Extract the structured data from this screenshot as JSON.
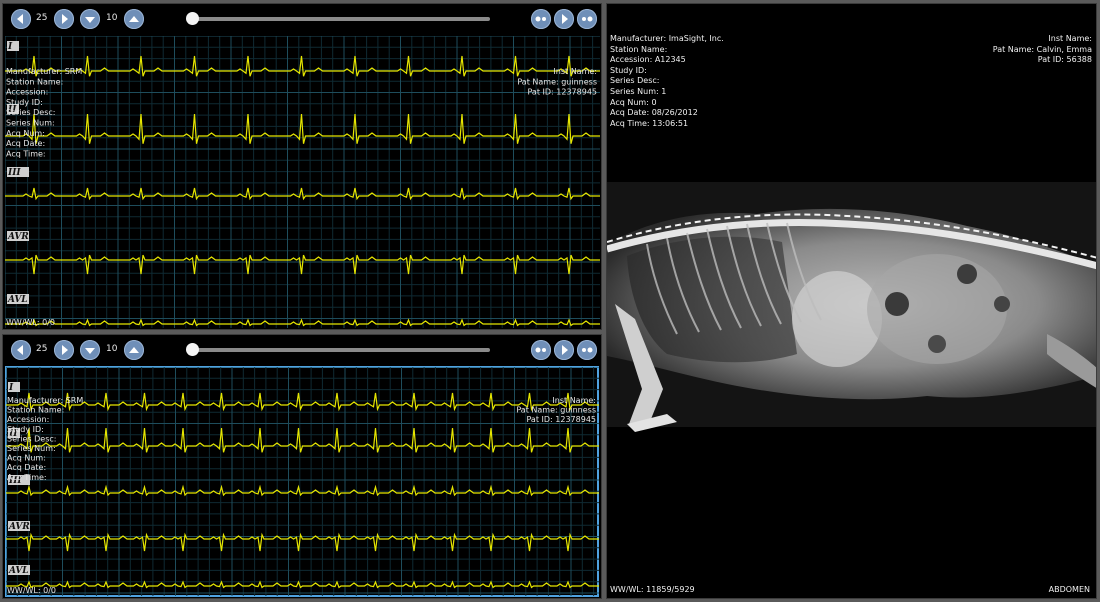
{
  "viewers": [
    {
      "id": "ecg-top",
      "controls": {
        "value_a": "25",
        "value_b": "10"
      },
      "info_left": [
        "Manufacturer: SRM",
        "Station Name:",
        "Accession:",
        "Study ID:",
        "Series Desc:",
        "Series Num:",
        "Acq Num:",
        "Acq Date:",
        "Acq Time:"
      ],
      "info_right": [
        "Inst Name:",
        "Pat Name: guinness",
        "Pat ID: 12378945"
      ],
      "leads": [
        "I",
        "II",
        "III",
        "AVR",
        "AVL"
      ],
      "wwwl": "WW/WL: 0/0"
    },
    {
      "id": "ecg-bottom",
      "controls": {
        "value_a": "25",
        "value_b": "10"
      },
      "info_left": [
        "Manufacturer: SRM",
        "Station Name:",
        "Accession:",
        "Study ID:",
        "Series Desc:",
        "Series Num:",
        "Acq Num:",
        "Acq Date:",
        "Acq Time:"
      ],
      "info_right": [
        "Inst Name:",
        "Pat Name: guinness",
        "Pat ID: 12378945"
      ],
      "leads": [
        "I",
        "II",
        "III",
        "AVR",
        "AVL"
      ],
      "wwwl": "WW/WL: 0/0"
    }
  ],
  "xray": {
    "info_left": [
      "Manufacturer: ImaSight, Inc.",
      "Station Name:",
      "Accession: A12345",
      "Study ID:",
      "Series Desc:",
      "Series Num: 1",
      "Acq Num: 0",
      "Acq Date: 08/26/2012",
      "Acq Time: 13:06:51"
    ],
    "info_right": [
      "Inst Name:",
      "Pat Name: Calvin, Emma",
      "Pat ID: 56388"
    ],
    "wwwl": "WW/WL: 11859/5929",
    "body_part": "ABDOMEN"
  },
  "colors": {
    "trace": "#e6e600",
    "grid_minor": "#0f2a33",
    "grid_major": "#1e4d5c",
    "button": "#6f8fb8",
    "selected_border": "#4fa2e0"
  },
  "icons": [
    "prev-arrow-icon",
    "next-arrow-icon",
    "down-arrow-icon",
    "up-arrow-icon",
    "step-back-icon",
    "play-icon",
    "step-forward-icon"
  ]
}
